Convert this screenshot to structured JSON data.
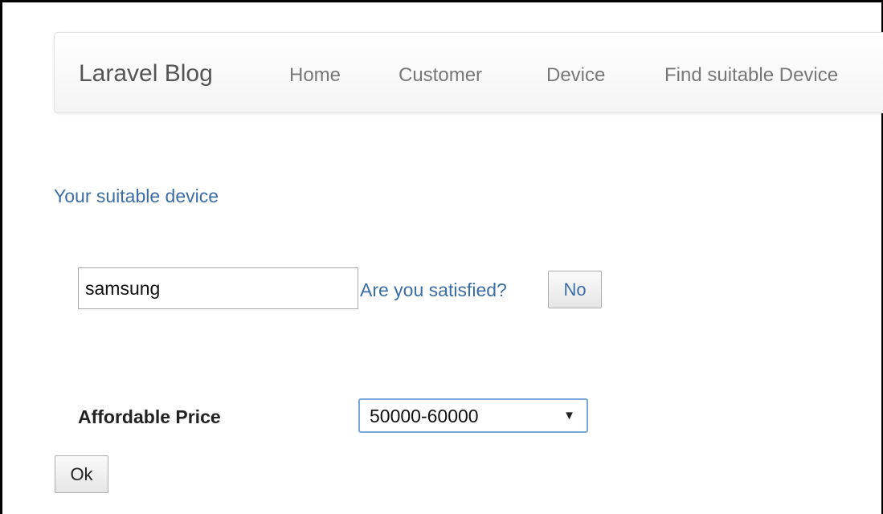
{
  "navbar": {
    "brand": "Laravel Blog",
    "links": [
      "Home",
      "Customer",
      "Device",
      "Find suitable Device"
    ]
  },
  "main": {
    "heading": "Your suitable device",
    "device_input_value": "samsung",
    "satisfied_question": "Are you satisfied?",
    "no_button": "No",
    "price_label": "Affordable Price",
    "price_selected": "50000-60000",
    "ok_button": "Ok"
  },
  "icons": {
    "dropdown_arrow": "chevron-down-icon"
  },
  "colors": {
    "link": "#3b6ea7",
    "nav_text": "#777777",
    "brand_text": "#555555",
    "select_border": "#7aa7d8"
  }
}
